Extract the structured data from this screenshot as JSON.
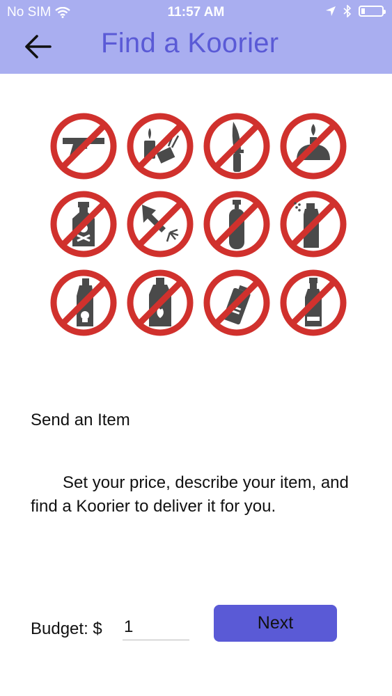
{
  "status_bar": {
    "carrier": "No SIM",
    "time": "11:57 AM"
  },
  "header": {
    "title": "Find a Koorier"
  },
  "prohibited_items": [
    {
      "icon": "gun-icon"
    },
    {
      "icon": "lighter-matches-icon"
    },
    {
      "icon": "knife-icon"
    },
    {
      "icon": "flammable-stove-icon"
    },
    {
      "icon": "poison-bottle-icon"
    },
    {
      "icon": "firework-icon"
    },
    {
      "icon": "gas-cylinder-icon"
    },
    {
      "icon": "aerosol-spray-icon"
    },
    {
      "icon": "toxic-bottle-icon"
    },
    {
      "icon": "flammable-liquid-icon"
    },
    {
      "icon": "battery-icon"
    },
    {
      "icon": "acid-bottle-icon"
    }
  ],
  "content": {
    "heading": "Send an Item",
    "description": "Set your price, describe your item, and find a Koorier to deliver it for you."
  },
  "budget": {
    "label": "Budget: $",
    "value": "1"
  },
  "actions": {
    "next_label": "Next"
  },
  "colors": {
    "header_bg": "#a9aef0",
    "accent": "#5a5ad6",
    "prohibition_red": "#d0312d",
    "icon_gray": "#4a4a4a"
  }
}
